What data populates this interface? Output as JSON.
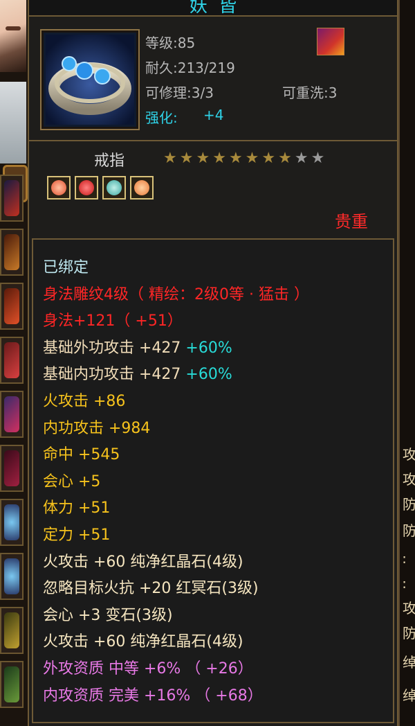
{
  "window": {
    "title": "妖 皆"
  },
  "item": {
    "icon": "ring-icon",
    "level": "等级:85",
    "durability": "耐久:213/219",
    "repairable": "可修理:3/3",
    "rewashable": "可重洗:3",
    "enhance_label": "强化:",
    "enhance_value": "+4",
    "type": "戒指",
    "stars_total": 10,
    "stars_filled": 8,
    "rarity": "贵重",
    "gems": [
      {
        "icon": "red-gem-icon",
        "color": "#e05030"
      },
      {
        "icon": "ruby-gem-icon",
        "color": "#c81818"
      },
      {
        "icon": "teal-gem-icon",
        "color": "#3aa8a0"
      },
      {
        "icon": "orange-gem-icon",
        "color": "#e87838"
      }
    ]
  },
  "attributes": {
    "bound": "已绑定",
    "carving": "身法雕纹4级（ 精绘：2级0等 · 猛击 ）",
    "agility": "身法+121（ +51）",
    "base_ext_attack": "基础外功攻击 +427",
    "base_ext_attack_pct": "+60%",
    "base_int_attack": "基础内功攻击 +427",
    "base_int_attack_pct": "+60%",
    "fire_attack": "火攻击 +86",
    "int_attack": "内功攻击 +984",
    "hit": "命中 +545",
    "crit": "会心 +5",
    "stamina": "体力 +51",
    "focus": "定力 +51",
    "gem_fire_1": "火攻击 +60 纯净红晶石(4级)",
    "gem_ignore_fire": "忽略目标火抗 +20 红冥石(3级)",
    "gem_crit": "会心 +3 变石(3级)",
    "gem_fire_2": "火攻击 +60 纯净红晶石(4级)",
    "ext_quality": "外攻资质   中等 +6% （ +26）",
    "int_quality": "内攻资质   完美 +16% （ +68）"
  },
  "right_edge_chars": [
    "攻",
    "攻",
    "防",
    "防",
    "∶",
    "∶",
    "攻",
    "防",
    "绰",
    "绰"
  ],
  "colors": {
    "panel_border": "#6e5a36",
    "cyan": "#2fd3e8",
    "red": "#ff2626",
    "yellow": "#f6c21c",
    "pink": "#e879e6",
    "star_filled": "#a88a3c",
    "star_empty": "#9a9a9a"
  }
}
